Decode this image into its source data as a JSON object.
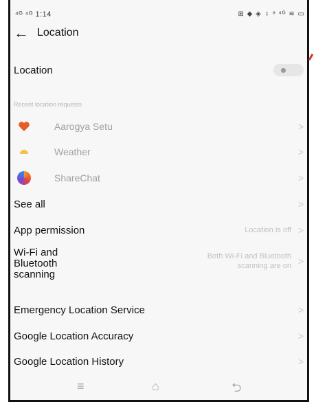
{
  "status": {
    "time": "1:14",
    "network": "⁴ᴳ ⁴ᴳ",
    "icons": "⊞ ◆ ◈ ♁ ᵊ ⁴ᴳ ≋ ▭"
  },
  "header": {
    "back_icon": "←",
    "title": "Location"
  },
  "location_toggle": {
    "label": "Location",
    "state": "off"
  },
  "recent": {
    "section_title": "Recent location requests",
    "apps": [
      {
        "name": "Aarogya Setu",
        "icon": "heart-icon",
        "color": "#e85c2a"
      },
      {
        "name": "Weather",
        "icon": "sun-icon",
        "color": "#f2c14e"
      },
      {
        "name": "ShareChat",
        "icon": "sharechat-icon",
        "color": "#f29b26"
      }
    ]
  },
  "see_all": "See all",
  "app_permission": {
    "label": "App permission",
    "value": "Location is off"
  },
  "wifi_bt": {
    "label_lines": [
      "Wi-Fi and",
      "Bluetooth",
      "scanning"
    ],
    "value_lines": [
      "Both Wi-Fi and Bluetooth",
      "scanning are on"
    ]
  },
  "services": [
    "Emergency Location Service",
    "Google Location Accuracy",
    "Google Location History"
  ],
  "chevron": ">",
  "nav": {
    "menu": "≡",
    "home": "⌂",
    "back": "⮌"
  }
}
